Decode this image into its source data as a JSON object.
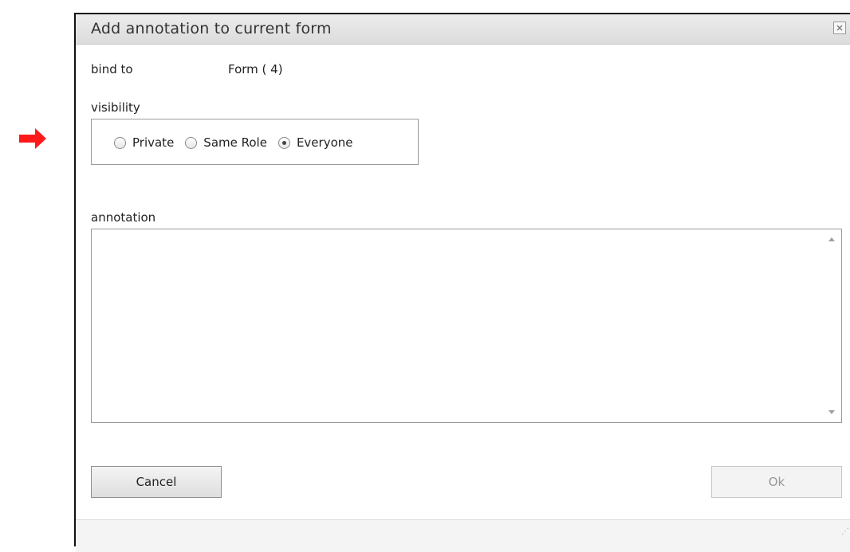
{
  "dialog": {
    "title": "Add annotation to current form",
    "bind_to_label": "bind to",
    "bind_to_value": "Form ( 4)",
    "visibility_label": "visibility",
    "visibility_options": [
      {
        "label": "Private",
        "checked": false
      },
      {
        "label": "Same Role",
        "checked": false
      },
      {
        "label": "Everyone",
        "checked": true
      }
    ],
    "annotation_label": "annotation",
    "annotation_value": "",
    "cancel_label": "Cancel",
    "ok_label": "Ok"
  },
  "icons": {
    "pointer": "right-arrow-icon",
    "close": "close-icon",
    "resize": "resize-grip-icon"
  },
  "colors": {
    "arrow": "#ff1a1a",
    "titlebar": "#e3e3e3",
    "border": "#9a9a9a"
  }
}
